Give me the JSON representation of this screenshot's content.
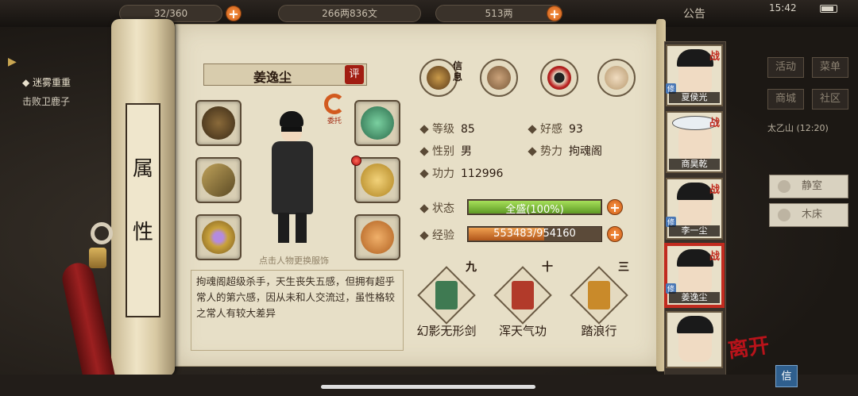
{
  "topbar": {
    "stamina": "32/360",
    "money": "266两836文",
    "gold": "513两",
    "notice": "公告",
    "time": "15:42"
  },
  "left_quest": {
    "title": "迷雾重重",
    "desc": "击败卫鹿子"
  },
  "scroll_title": [
    "属",
    "性"
  ],
  "character": {
    "name": "姜逸尘",
    "rate_label": "评",
    "entrust_label": "委托",
    "change_hint": "点击人物更换服饰",
    "description": "拘魂阁超级杀手，天生丧失五感，但拥有超乎常人的第六感，因从未和人交流过，虽性格较之常人有较大差异"
  },
  "tabs": [
    {
      "name": "info",
      "label": "信息"
    },
    {
      "name": "map",
      "label": ""
    },
    {
      "name": "bagua",
      "label": ""
    },
    {
      "name": "meridian",
      "label": ""
    }
  ],
  "stats": {
    "level_k": "等级",
    "level_v": "85",
    "favor_k": "好感",
    "favor_v": "93",
    "gender_k": "性别",
    "gender_v": "男",
    "faction_k": "势力",
    "faction_v": "拘魂阁",
    "power_k": "功力",
    "power_v": "112996",
    "status_k": "状态",
    "status_v": "全盛(100%)",
    "status_fill": 1.0,
    "exp_k": "经验",
    "exp_v": "553483/954160",
    "exp_fill": 0.58
  },
  "skills": [
    {
      "name": "幻影无形剑",
      "level": "九",
      "color": "#3f7a52"
    },
    {
      "name": "浑天气功",
      "level": "十",
      "color": "#b23a2a"
    },
    {
      "name": "踏浪行",
      "level": "三",
      "color": "#c98a2a"
    }
  ],
  "roster": [
    {
      "name": "夏侯光",
      "battle": "战",
      "tag": "修"
    },
    {
      "name": "商昊乾",
      "battle": "战",
      "tag": ""
    },
    {
      "name": "李一尘",
      "battle": "战",
      "tag": "修"
    },
    {
      "name": "姜逸尘",
      "battle": "战",
      "tag": "修"
    },
    {
      "name": "",
      "battle": "",
      "tag": ""
    }
  ],
  "right_menu": {
    "activity": "活动",
    "menu": "菜单",
    "shop": "商城",
    "community": "社区",
    "location": "太乙山",
    "location_time": "(12:20)",
    "rooms": [
      "静室",
      "木床"
    ]
  },
  "leave_label": "离开",
  "mail_label": "信",
  "colors": {
    "status_fill": "#7fbf3a",
    "exp_fill": "#d9762a",
    "accent_red": "#c12b1f"
  }
}
